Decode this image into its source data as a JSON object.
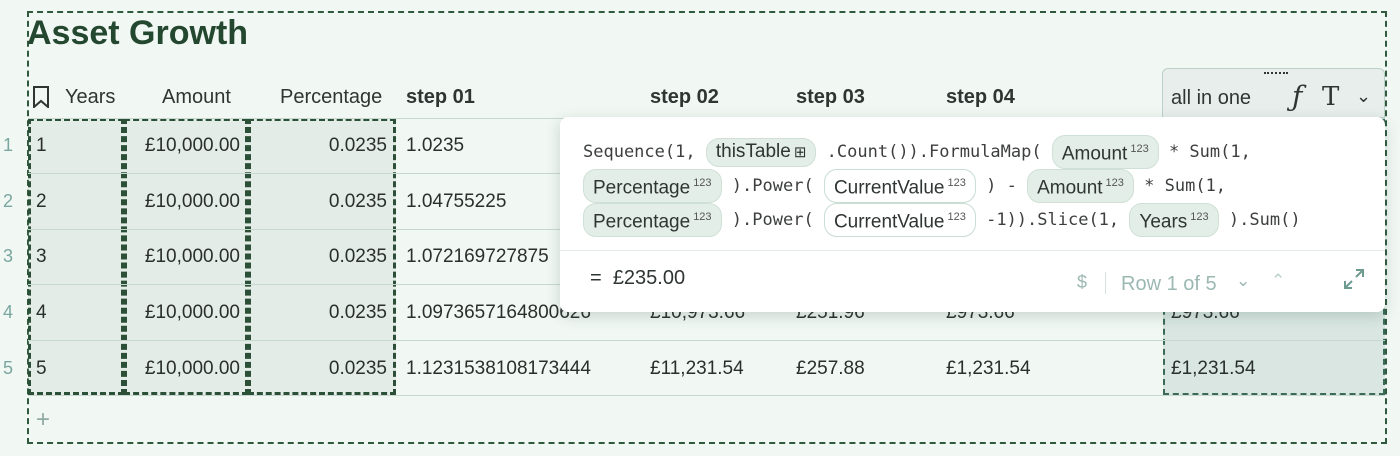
{
  "table": {
    "title": "Asset Growth",
    "columns": [
      "Years",
      "Amount",
      "Percentage",
      "step 01",
      "step 02",
      "step 03",
      "step 04",
      "all in one"
    ],
    "row_numbers": [
      "1",
      "2",
      "3",
      "4",
      "5"
    ],
    "rows": [
      {
        "years": "1",
        "amount": "£10,000.00",
        "percentage": "0.0235",
        "step01": "1.0235",
        "step02": "",
        "step03": "",
        "step04": "",
        "aio": ""
      },
      {
        "years": "2",
        "amount": "£10,000.00",
        "percentage": "0.0235",
        "step01": "1.04755225",
        "step02": "",
        "step03": "",
        "step04": "",
        "aio": ""
      },
      {
        "years": "3",
        "amount": "£10,000.00",
        "percentage": "0.0235",
        "step01": "1.072169727875",
        "step02": "",
        "step03": "",
        "step04": "",
        "aio": ""
      },
      {
        "years": "4",
        "amount": "£10,000.00",
        "percentage": "0.0235",
        "step01": "1.0973657164800626",
        "step02": "£10,973.66",
        "step03": "£251.96",
        "step04": "£973.66",
        "aio": "£973.66"
      },
      {
        "years": "5",
        "amount": "£10,000.00",
        "percentage": "0.0235",
        "step01": "1.1231538108173444",
        "step02": "£11,231.54",
        "step03": "£257.88",
        "step04": "£1,231.54",
        "aio": "£1,231.54"
      }
    ],
    "add_row_label": "+"
  },
  "formula_popup": {
    "tokens": {
      "seq": "Sequence(1,",
      "this_table": "thisTable",
      "count": ".Count()).FormulaMap(",
      "amount": "Amount",
      "times_sum": "* Sum(1,",
      "percentage": "Percentage",
      "power": ").Power(",
      "current_value": "CurrentValue",
      "close_minus": ") -",
      "minus_one": "-1)).Slice(1,",
      "years": "Years",
      "sum_end": ").Sum()",
      "num_badge": "123"
    },
    "result_prefix": "=",
    "result": "£235.00",
    "currency_symbol": "$",
    "row_indicator": "Row 1 of 5"
  },
  "icons": {
    "header": "bookmark-icon",
    "formula": "function-icon",
    "text_format": "text-format-icon",
    "menu": "chevron-down-icon",
    "nav_down": "chevron-down-icon",
    "nav_up": "chevron-up-icon",
    "expand": "expand-icon",
    "table": "table-icon"
  },
  "colors": {
    "accent": "#24472f",
    "selection_border": "#2c5037",
    "background": "#f1f7f3"
  }
}
